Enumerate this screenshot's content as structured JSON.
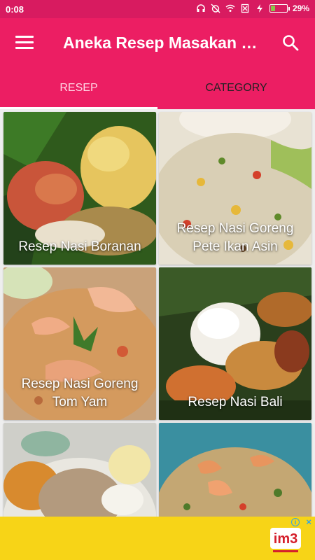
{
  "status_bar": {
    "time": "0:08",
    "battery_percent": "29%",
    "battery_level": 0.29
  },
  "app_bar": {
    "title": "Aneka Resep Masakan Nasi",
    "menu_icon": "hamburger-menu-icon",
    "search_icon": "search-icon"
  },
  "tabs": [
    {
      "label": "RESEP",
      "active": true
    },
    {
      "label": "CATEGORY",
      "active": false
    }
  ],
  "recipes": [
    {
      "title": "Resep Nasi Boranan"
    },
    {
      "title": "Resep Nasi Goreng Pete Ikan Asin"
    },
    {
      "title": "Resep Nasi Goreng Tom Yam"
    },
    {
      "title": "Resep Nasi Bali"
    },
    {
      "title": ""
    },
    {
      "title": ""
    }
  ],
  "ad": {
    "brand": "im3",
    "info_icon": "i",
    "close_icon": "×"
  },
  "colors": {
    "primary": "#ec1e63",
    "status_bar": "#d81b60",
    "ad_background": "#f7d417"
  }
}
